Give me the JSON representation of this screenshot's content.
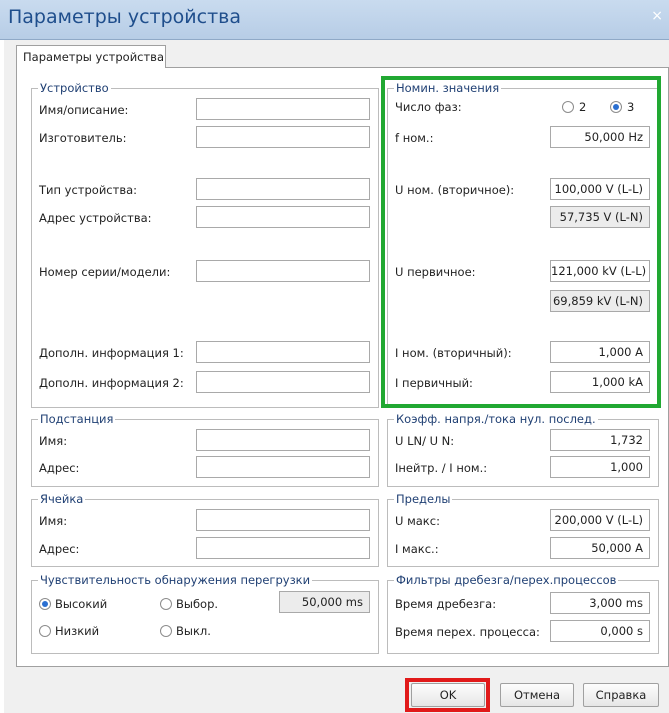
{
  "window": {
    "title": "Параметры устройства",
    "close_glyph": "×"
  },
  "tab": {
    "label": "Параметры устройства"
  },
  "device": {
    "legend": "Устройство",
    "fields": [
      {
        "label": "Имя/описание:",
        "value": ""
      },
      {
        "label": "Изготовитель:",
        "value": ""
      },
      {
        "label": "Тип устройства:",
        "value": ""
      },
      {
        "label": "Адрес устройства:",
        "value": ""
      },
      {
        "label": "Номер серии/модели:",
        "value": ""
      },
      {
        "label": "Дополн. информация 1:",
        "value": ""
      },
      {
        "label": "Дополн. информация 2:",
        "value": ""
      }
    ]
  },
  "nominal": {
    "legend": "Номин. значения",
    "phases_label": "Число фаз:",
    "phase_option_2": "2",
    "phase_option_3": "3",
    "selected_phase": "3",
    "fnom_label": "f ном.:",
    "fnom_value": "50,000  Hz",
    "unom_label": "U ном. (вторичное):",
    "unom_ll": "100,000  V (L-L)",
    "unom_ln": "57,735  V (L-N)",
    "uprim_label": "U первичное:",
    "uprim_ll": "121,000  kV (L-L)",
    "uprim_ln": "69,859  kV (L-N)",
    "inom_label": "I ном. (вторичный):",
    "inom_value": "1,000  A",
    "iprim_label": "I первичный:",
    "iprim_value": "1,000  kA"
  },
  "substation": {
    "legend": "Подстанция",
    "name_label": "Имя:",
    "name_value": "",
    "address_label": "Адрес:",
    "address_value": ""
  },
  "coef": {
    "legend": "Коэфф. напря./тока нул. послед.",
    "uln_label": "U LN/ U N:",
    "uln_value": "1,732",
    "ineutr_label": "Iнейтр. / I ном.:",
    "ineutr_value": "1,000"
  },
  "cell": {
    "legend": "Ячейка",
    "name_label": "Имя:",
    "name_value": "",
    "address_label": "Адрес:",
    "address_value": ""
  },
  "limits": {
    "legend": "Пределы",
    "umax_label": "U макс:",
    "umax_value": "200,000  V (L-L)",
    "imax_label": "I макс.:",
    "imax_value": "50,000  A"
  },
  "overload": {
    "legend": "Чувствительность обнаружения перегрузки",
    "high": "Высокий",
    "select": "Выбор.",
    "low": "Низкий",
    "off": "Выкл.",
    "selected": "Высокий",
    "value": "50,000  ms"
  },
  "filters": {
    "legend": "Фильтры дребезга/перех.процессов",
    "bounce_label": "Время дребезга:",
    "bounce_value": "3,000  ms",
    "transient_label": "Время перех. процесса:",
    "transient_value": "0,000  s"
  },
  "buttons": {
    "ok": "OK",
    "cancel": "Отмена",
    "help": "Справка"
  },
  "colors": {
    "highlight_green": "#21a832",
    "highlight_red": "#e11a1a",
    "title_blue": "#1f4e8c"
  }
}
